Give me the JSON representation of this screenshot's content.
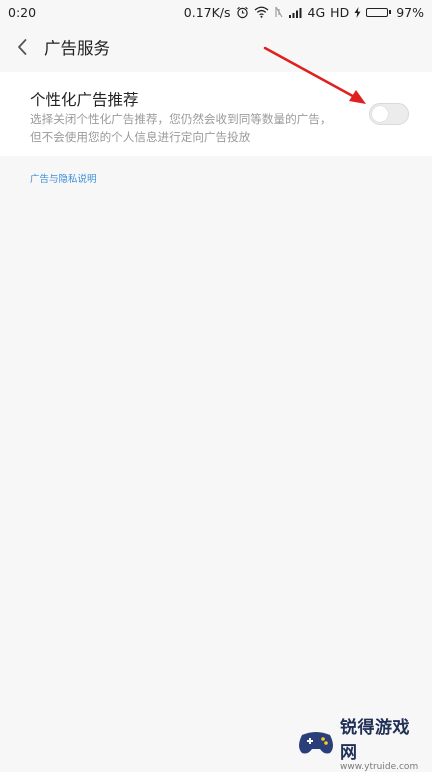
{
  "status_bar": {
    "time": "0:20",
    "net_speed": "0.17K/s",
    "network_type": "4G",
    "hd_label": "HD",
    "battery_percent": "97%",
    "battery_level": 0.97
  },
  "title_bar": {
    "back_icon": "chevron-left-icon",
    "title": "广告服务"
  },
  "setting": {
    "title": "个性化广告推荐",
    "description": "选择关闭个性化广告推荐，您仍然会收到同等数量的广告，但不会使用您的个人信息进行定向广告投放",
    "toggle_on": false
  },
  "privacy_link": "广告与隐私说明",
  "watermark": {
    "name": "锐得游戏网",
    "url": "www.ytruide.com"
  },
  "colors": {
    "arrow": "#e02020",
    "link": "#3b8fd8",
    "battery": "#3ec93e"
  }
}
